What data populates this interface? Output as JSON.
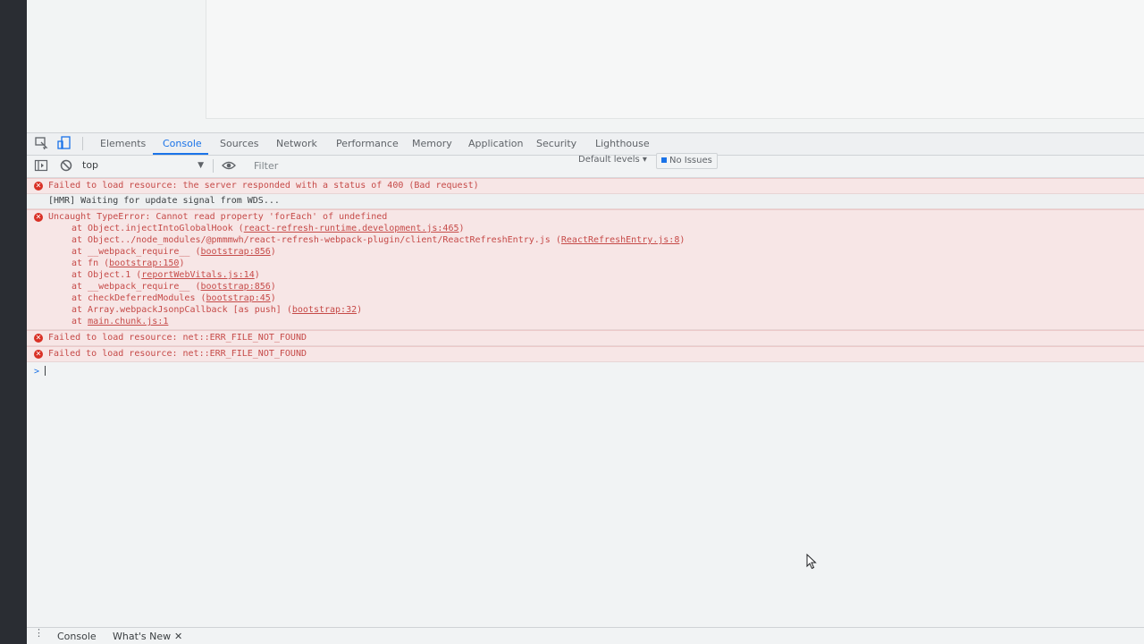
{
  "devtools": {
    "tabs": [
      {
        "label": "Elements"
      },
      {
        "label": "Console"
      },
      {
        "label": "Sources"
      },
      {
        "label": "Network"
      },
      {
        "label": "Performance"
      },
      {
        "label": "Memory"
      },
      {
        "label": "Application"
      },
      {
        "label": "Security"
      },
      {
        "label": "Lighthouse"
      }
    ],
    "active_tab": "Console",
    "toolbar": {
      "context": "top",
      "filter_placeholder": "Filter",
      "levels_label": "Default levels ▾",
      "issues_label": "No Issues"
    },
    "messages": {
      "error1": "Failed to load resource: the server responded with a status of 400 (Bad request)",
      "log1": "[HMR] Waiting for update signal from WDS...",
      "error2_title": "Uncaught TypeError: Cannot read property 'forEach' of undefined",
      "stack": [
        {
          "text": "at Object.injectIntoGlobalHook ",
          "link": "react-refresh-runtime.development.js:465",
          "close": ")"
        },
        {
          "text": "at Object../node_modules/@pmmmwh/react-refresh-webpack-plugin/client/ReactRefreshEntry.js ",
          "link": "ReactRefreshEntry.js:8",
          "close": ")"
        },
        {
          "text": "at __webpack_require__ ",
          "link": "bootstrap:856",
          "close": ")"
        },
        {
          "text": "at fn ",
          "link": "bootstrap:150",
          "close": ")"
        },
        {
          "text": "at Object.1 ",
          "link": "reportWebVitals.js:14",
          "close": ")"
        },
        {
          "text": "at __webpack_require__ ",
          "link": "bootstrap:856",
          "close": ")"
        },
        {
          "text": "at checkDeferredModules ",
          "link": "bootstrap:45",
          "close": ")"
        },
        {
          "text": "at Array.webpackJsonpCallback [as push] ",
          "link": "bootstrap:32",
          "close": ")"
        },
        {
          "text": "at ",
          "link": "main.chunk.js:1",
          "close": ""
        }
      ],
      "error3": "Failed to load resource: net::ERR_FILE_NOT_FOUND",
      "error4": "Failed to load resource: net::ERR_FILE_NOT_FOUND"
    },
    "prompt_symbol": ">",
    "drawer": {
      "menu_icon": "⋮",
      "tabs": [
        {
          "label": "Console"
        },
        {
          "label": "What's New"
        }
      ],
      "close_symbol": "✕"
    },
    "colors": {
      "accent": "#1a73e8",
      "error_text": "#c64a48",
      "error_bg": "#f7e6e6"
    }
  }
}
